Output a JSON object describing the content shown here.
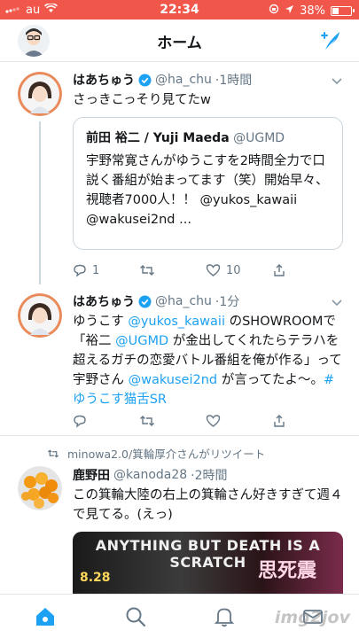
{
  "status": {
    "carrier": "au",
    "time": "22:34",
    "battery": "38%",
    "battery_level": 0.38
  },
  "header": {
    "title": "ホーム"
  },
  "tweets": [
    {
      "name": "はあちゅう",
      "handle": "@ha_chu",
      "time": "·1時間",
      "text": "さっきこっそり見てたw",
      "quote": {
        "name": "前田 裕二 / Yuji Maeda",
        "handle": "@UGMD",
        "text": "宇野常寛さんがゆうこすを2時間全力で口説く番組が始まってます（笑）開始早々、視聴者7000人！！ @yukos_kawaii @wakusei2nd ..."
      },
      "replies": "1",
      "retweets": "",
      "likes": "10"
    },
    {
      "name": "はあちゅう",
      "handle": "@ha_chu",
      "time": "·1分",
      "text_parts": {
        "p1": "ゆうこす ",
        "l1": "@yukos_kawaii",
        "p2": " のSHOWROOMで「裕二 ",
        "l2": "@UGMD",
        "p3": " が金出してくれたらテラハを超えるガチの恋愛バトル番組を俺が作る」って宇野さん ",
        "l3": "@wakusei2nd",
        "p4": " が言ってたよ〜。",
        "l4": "#ゆうこす猫舌SR"
      }
    },
    {
      "retweeted_by": "minowa2.0/箕輪厚介さんがリツイート",
      "name": "鹿野田",
      "handle": "@kanoda28",
      "time": "·2時間",
      "text": "この箕輪大陸の右上の箕輪さん好きすぎて週４で見てる。(えっ)",
      "media": {
        "banner": "ANYTHING BUT DEATH IS A SCRATCH",
        "kanji": "思死震",
        "date": "8.28"
      }
    }
  ],
  "watermark": "img2jov",
  "colors": {
    "accent": "#1da1f2",
    "statusbar": "#f0564a"
  }
}
